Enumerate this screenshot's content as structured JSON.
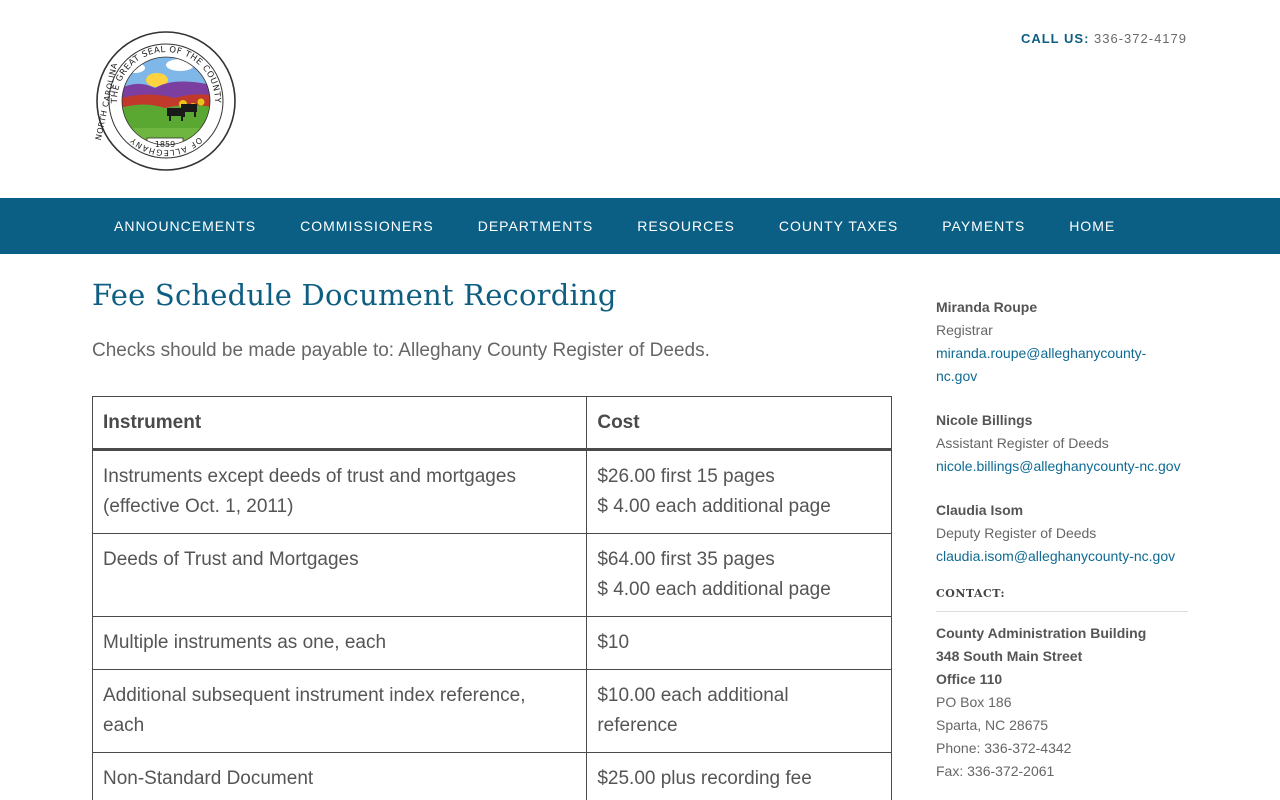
{
  "header": {
    "call_label": "CALL US:",
    "call_number": "336-372-4179",
    "seal": {
      "top_text": "THE GREAT SEAL OF THE COUNTY",
      "left_text": "NORTH CAROLINA",
      "bottom_text": "OF ALLEGHANY",
      "year": "1859"
    }
  },
  "nav": {
    "items": [
      "ANNOUNCEMENTS",
      "COMMISSIONERS",
      "DEPARTMENTS",
      "RESOURCES",
      "COUNTY TAXES",
      "PAYMENTS",
      "HOME"
    ]
  },
  "main": {
    "title": "Fee Schedule Document Recording",
    "intro": "Checks should be made payable to: Alleghany County Register of Deeds.",
    "table": {
      "headers": [
        "Instrument",
        "Cost"
      ],
      "rows": [
        {
          "instrument": [
            "Instruments except deeds of trust and mortgages",
            "(effective Oct. 1, 2011)"
          ],
          "cost": [
            "$26.00 first 15 pages",
            "$ 4.00 each additional page"
          ]
        },
        {
          "instrument": [
            "Deeds of Trust and Mortgages"
          ],
          "cost": [
            "$64.00 first 35 pages",
            "$ 4.00 each additional page"
          ]
        },
        {
          "instrument": [
            "Multiple instruments as one, each"
          ],
          "cost": [
            "$10"
          ]
        },
        {
          "instrument": [
            "Additional subsequent instrument index reference,",
            "each"
          ],
          "cost": [
            "$10.00 each additional",
            "reference"
          ]
        },
        {
          "instrument": [
            "Non-Standard Document"
          ],
          "cost": [
            "$25.00 plus recording fee"
          ]
        }
      ]
    }
  },
  "sidebar": {
    "people": [
      {
        "name": "Miranda Roupe",
        "role": "Registrar",
        "email_lines": [
          "miranda.roupe@alleghanycounty-",
          "nc.gov"
        ]
      },
      {
        "name": "Nicole Billings",
        "role": "Assistant Register of Deeds",
        "email_lines": [
          "nicole.billings@alleghanycounty-nc.gov"
        ]
      },
      {
        "name": "Claudia Isom",
        "role": "Deputy Register of Deeds",
        "email_lines": [
          "claudia.isom@alleghanycounty-nc.gov"
        ]
      }
    ],
    "contact_heading": "CONTACT:",
    "address": {
      "bold_lines": [
        "County Administration Building",
        "348 South Main Street",
        "Office 110"
      ],
      "lines": [
        "PO Box 186",
        "Sparta, NC 28675",
        "Phone: 336-372-4342",
        "Fax: 336-372-2061"
      ]
    }
  },
  "colors": {
    "nav_bg": "#0b5f85",
    "accent": "#0e5e82",
    "link": "#0e6a93"
  }
}
